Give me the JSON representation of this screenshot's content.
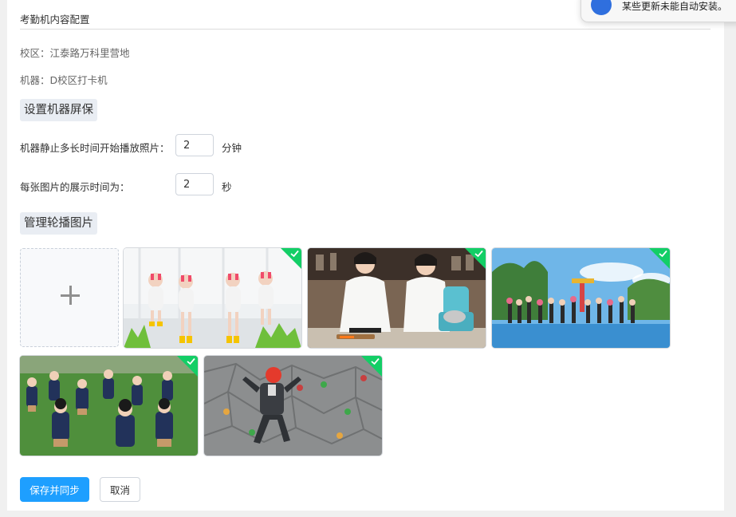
{
  "header": {
    "title": "考勤机内容配置"
  },
  "info": {
    "campus": "校区：江泰路万科里营地",
    "machine": "机器：D校区打卡机"
  },
  "screensaver": {
    "section_title": "设置机器屏保",
    "idle_label": "机器静止多长时间开始播放照片：",
    "idle_value": "2",
    "idle_unit": "分钟",
    "duration_label": "每张图片的展示时间为：",
    "duration_value": "2",
    "duration_unit": "秒"
  },
  "carousel": {
    "section_title": "管理轮播图片",
    "images": [
      {
        "name": "children-costume-photo",
        "selected": true
      },
      {
        "name": "chefs-kitchen-photo",
        "selected": true
      },
      {
        "name": "group-waterpark-photo",
        "selected": true
      },
      {
        "name": "students-field-photo",
        "selected": true
      },
      {
        "name": "child-climbing-photo",
        "selected": true
      }
    ]
  },
  "actions": {
    "save_label": "保存并同步",
    "cancel_label": "取消"
  },
  "notification": {
    "message": "某些更新未能自动安装。"
  },
  "colors": {
    "primary": "#1e9fff",
    "check_badge": "#13ce66",
    "section_bg": "#e9edf3"
  }
}
